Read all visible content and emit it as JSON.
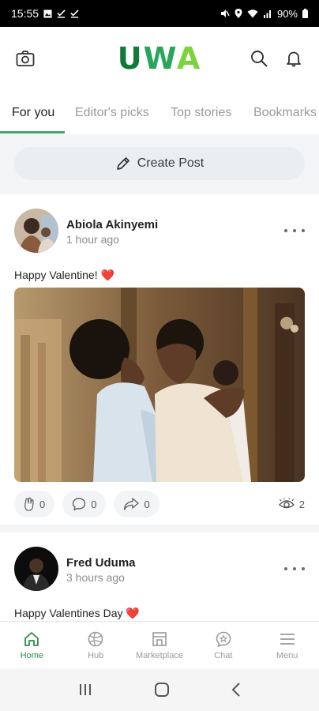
{
  "status_bar": {
    "time": "15:55",
    "battery": "90%"
  },
  "header": {
    "logo": {
      "u": "U",
      "w": "W",
      "a": "A"
    },
    "camera_icon": "camera-icon",
    "search_icon": "search-icon",
    "bell_icon": "bell-icon"
  },
  "tabs": [
    {
      "label": "For you",
      "active": true
    },
    {
      "label": "Editor's picks",
      "active": false
    },
    {
      "label": "Top stories",
      "active": false
    },
    {
      "label": "Bookmarks",
      "active": false
    }
  ],
  "create_post": {
    "label": "Create Post",
    "icon": "pencil-icon"
  },
  "posts": [
    {
      "author": "Abiola Akinyemi",
      "time": "1 hour ago",
      "text": "Happy Valentine!",
      "emoji": "❤️",
      "likes": "0",
      "comments": "0",
      "shares": "0",
      "views": "2"
    },
    {
      "author": "Fred Uduma",
      "time": "3 hours ago",
      "text": "Happy Valentines Day",
      "emoji": "❤️"
    }
  ],
  "bottom_nav": [
    {
      "label": "Home",
      "icon": "home-icon",
      "active": true
    },
    {
      "label": "Hub",
      "icon": "ball-icon",
      "active": false
    },
    {
      "label": "Marketplace",
      "icon": "store-icon",
      "active": false
    },
    {
      "label": "Chat",
      "icon": "chat-icon",
      "active": false
    },
    {
      "label": "Menu",
      "icon": "menu-icon",
      "active": false
    }
  ],
  "colors": {
    "brand_green": "#2e8b4d",
    "heart_red": "#e0243a"
  }
}
